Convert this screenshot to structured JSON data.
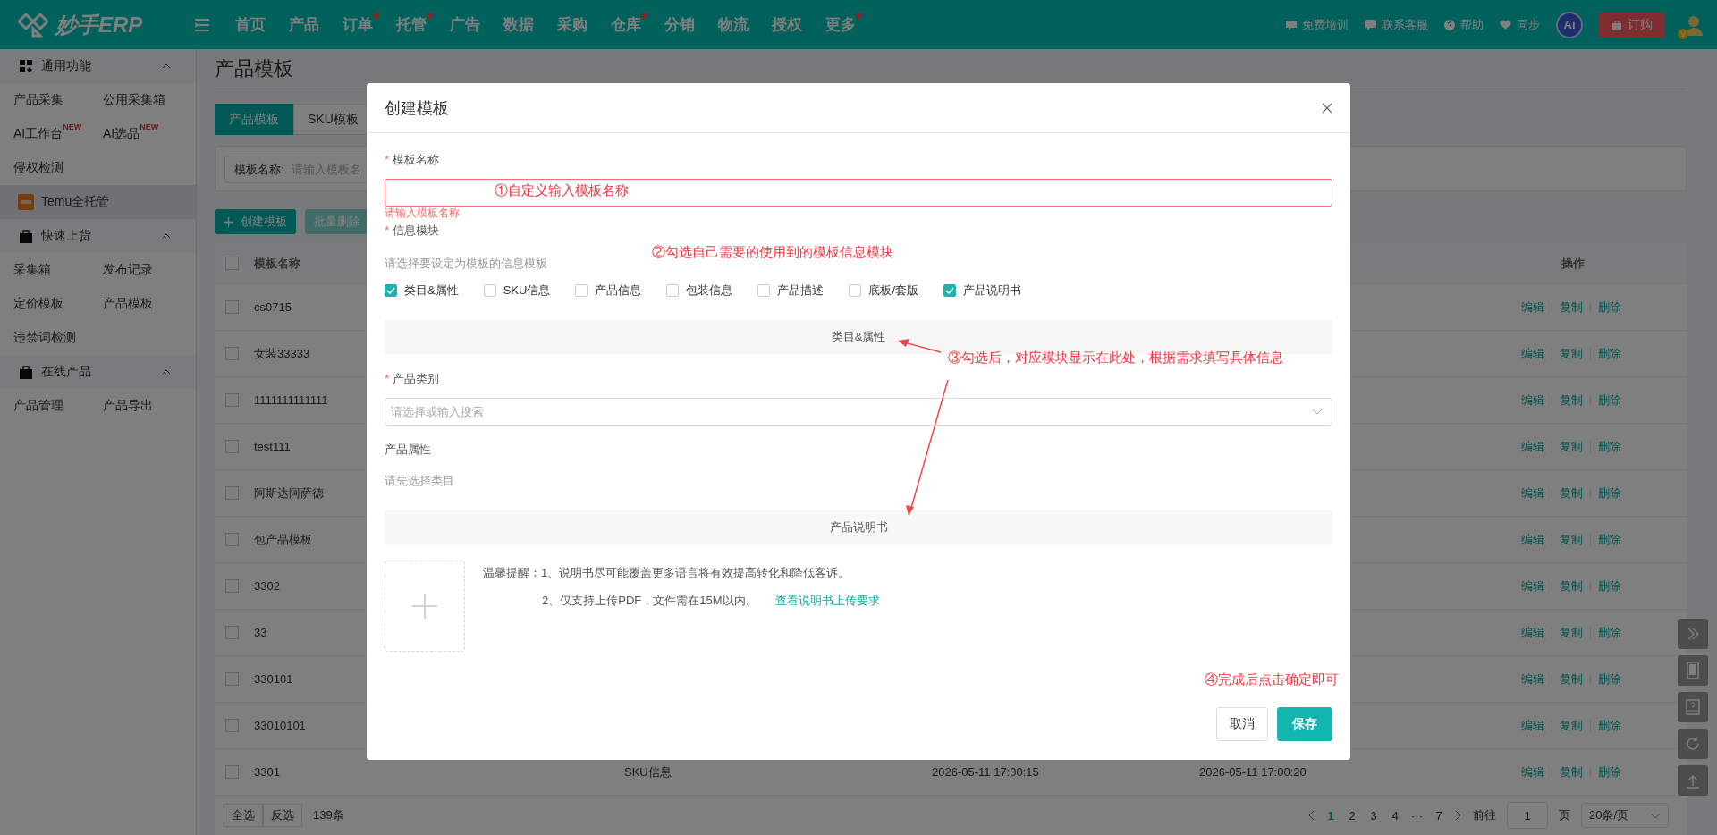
{
  "topbar": {
    "logo": "妙手ERP",
    "nav": [
      {
        "label": "首页",
        "dot": false
      },
      {
        "label": "产品",
        "dot": false
      },
      {
        "label": "订单",
        "dot": true
      },
      {
        "label": "托管",
        "dot": true
      },
      {
        "label": "广告",
        "dot": false
      },
      {
        "label": "数据",
        "dot": false
      },
      {
        "label": "采购",
        "dot": false
      },
      {
        "label": "仓库",
        "dot": true
      },
      {
        "label": "分销",
        "dot": false
      },
      {
        "label": "物流",
        "dot": false
      },
      {
        "label": "授权",
        "dot": false
      },
      {
        "label": "更多",
        "dot": true
      }
    ],
    "links": [
      {
        "label": "免费培训",
        "kind": "training"
      },
      {
        "label": "联系客服",
        "kind": "service"
      },
      {
        "label": "帮助",
        "kind": "help"
      },
      {
        "label": "同步",
        "kind": "sync"
      }
    ],
    "ai_badge": "Ai",
    "order_button": "订购",
    "user_badge": "V"
  },
  "sidebar": {
    "sections": [
      {
        "kind": "group",
        "title": "通用功能",
        "expanded": true,
        "items": [
          {
            "label": "产品采集"
          },
          {
            "label": "公用采集箱"
          },
          {
            "label": "AI工作台",
            "badge": "NEW"
          },
          {
            "label": "AI选品",
            "badge": "NEW"
          },
          {
            "label": "侵权检测"
          }
        ]
      },
      {
        "kind": "link",
        "title": "Temu全托管",
        "selected": true
      },
      {
        "kind": "group",
        "title": "快速上货",
        "expanded": true,
        "items": [
          {
            "label": "采集箱"
          },
          {
            "label": "发布记录"
          },
          {
            "label": "定价模板"
          },
          {
            "label": "产品模板"
          },
          {
            "label": "违禁词检测"
          }
        ]
      },
      {
        "kind": "group",
        "title": "在线产品",
        "expanded": true,
        "items": [
          {
            "label": "产品管理"
          },
          {
            "label": "产品导出"
          }
        ]
      }
    ]
  },
  "page": {
    "title": "产品模板",
    "tabs": [
      {
        "label": "产品模板",
        "selected": true
      },
      {
        "label": "SKU模板",
        "selected": false
      }
    ],
    "search": {
      "label": "模板名称:",
      "placeholder": "请输入模板名"
    },
    "actions": [
      {
        "label": "创建模板",
        "kind": "create",
        "disabled": false
      },
      {
        "label": "批量删除",
        "kind": "delete",
        "disabled": true
      }
    ],
    "table": {
      "columns": [
        "模板名称",
        "操作"
      ],
      "all_checked": false,
      "rows": [
        {
          "name": "cs0715",
          "checked": false,
          "actions": [
            "编辑",
            "复制",
            "删除"
          ]
        },
        {
          "name": "女装33333",
          "checked": false,
          "actions": [
            "编辑",
            "复制",
            "删除"
          ]
        },
        {
          "name": "1111111111111",
          "checked": false,
          "actions": [
            "编辑",
            "复制",
            "删除"
          ]
        },
        {
          "name": "test111",
          "checked": false,
          "actions": [
            "编辑",
            "复制",
            "删除"
          ]
        },
        {
          "name": "阿斯达阿萨德",
          "checked": false,
          "actions": [
            "编辑",
            "复制",
            "删除"
          ]
        },
        {
          "name": "包产品模板",
          "checked": false,
          "actions": [
            "编辑",
            "复制",
            "删除"
          ]
        },
        {
          "name": "3302",
          "checked": false,
          "actions": [
            "编辑",
            "复制",
            "删除"
          ]
        },
        {
          "name": "33",
          "checked": false,
          "actions": [
            "编辑",
            "复制",
            "删除"
          ]
        },
        {
          "name": "330101",
          "checked": false,
          "actions": [
            "编辑",
            "复制",
            "删除"
          ]
        },
        {
          "name": "33010101",
          "checked": false,
          "actions": [
            "编辑",
            "复制",
            "删除"
          ]
        },
        {
          "name": "3301",
          "checked": false,
          "cells": [
            "SKU信息",
            "2026-05-11 17:00:15",
            "2026-05-11 17:00:20"
          ],
          "actions": [
            "编辑",
            "复制",
            "删除"
          ]
        }
      ]
    },
    "footer": {
      "select_all": "全选",
      "invert": "反选",
      "total": "139条",
      "pages": [
        {
          "label": "1",
          "selected": true
        },
        {
          "label": "2",
          "selected": false
        },
        {
          "label": "3",
          "selected": false
        },
        {
          "label": "4",
          "selected": false
        },
        {
          "label": "···",
          "selected": false
        },
        {
          "label": "7",
          "selected": false
        }
      ],
      "goto": "前往",
      "page_value": "1",
      "page_unit": "页",
      "page_size": "20条/页"
    }
  },
  "modal": {
    "title": "创建模板",
    "required_mark": "*",
    "name_label": "模板名称",
    "name_error": "请输入模板名称",
    "modules_label": "信息模块",
    "modules_hint": "请选择要设定为模板的信息模板",
    "modules": [
      {
        "label": "类目&属性",
        "checked": true
      },
      {
        "label": "SKU信息",
        "checked": false
      },
      {
        "label": "产品信息",
        "checked": false
      },
      {
        "label": "包装信息",
        "checked": false
      },
      {
        "label": "产品描述",
        "checked": false
      },
      {
        "label": "底板/套版",
        "checked": false
      },
      {
        "label": "产品说明书",
        "checked": true
      }
    ],
    "section_1": "类目&属性",
    "category_label": "产品类别",
    "category_placeholder": "请选择或输入搜索",
    "attributes_label": "产品属性",
    "attributes_hint": "请先选择类目",
    "section_2": "产品说明书",
    "tips_1": "温馨提醒：1、说明书尽可能覆盖更多语言将有效提高转化和降低客诉。",
    "tips_2": "2、仅支持上传PDF，文件需在15M以内。",
    "tips_link": "查看说明书上传要求",
    "buttons": [
      {
        "label": "取消",
        "kind": "cancel"
      },
      {
        "label": "保存",
        "kind": "primary"
      }
    ]
  },
  "annotations": [
    "①自定义输入模板名称",
    "②勾选自己需要的使用到的模板信息模块",
    "③勾选后，对应模块显示在此处，根据需求填写具体信息",
    "④完成后点击确定即可"
  ]
}
